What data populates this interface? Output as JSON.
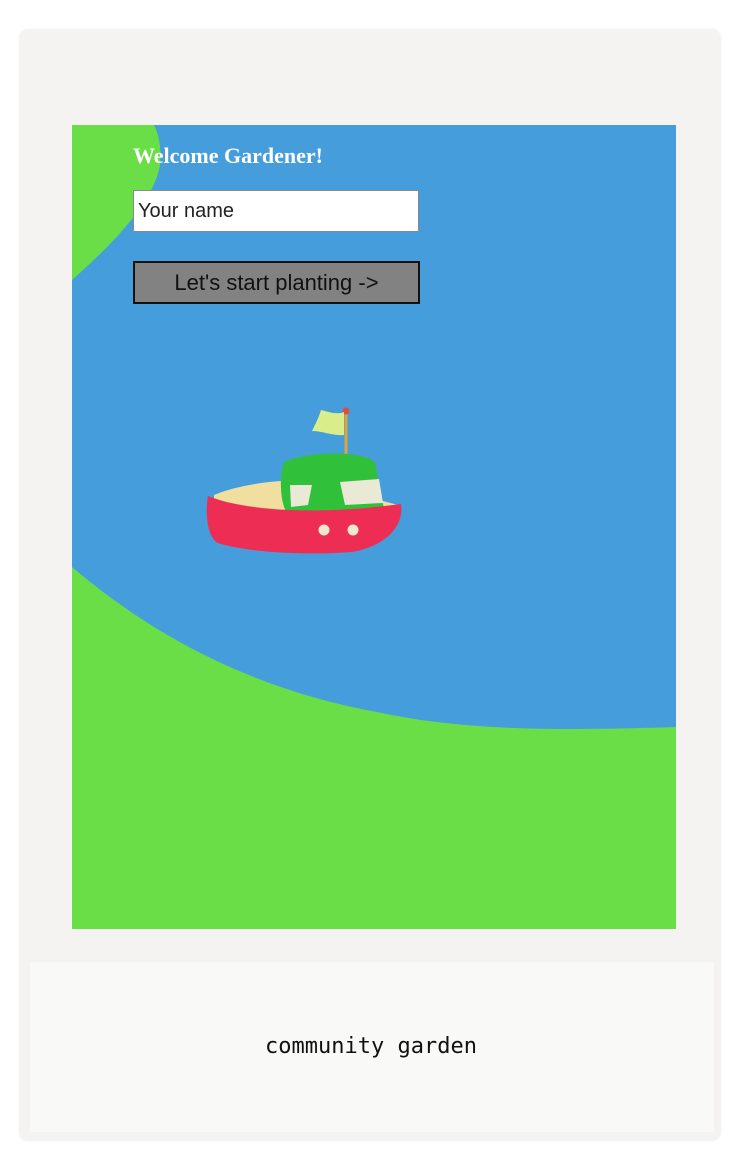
{
  "screen": {
    "welcome_text": "Welcome Gardener!",
    "name_input": {
      "placeholder": "Your name",
      "value": ""
    },
    "start_button_label": "Let's start planting ->"
  },
  "card": {
    "caption": "community garden"
  },
  "colors": {
    "water": "#469ddb",
    "grass": "#6ade46",
    "boat_hull": "#ee2d55",
    "boat_cabin": "#30c03a",
    "boat_deck": "#f1dfa0",
    "flag": "#d9ee8a",
    "button_bg": "#828282",
    "card_bg": "#f4f3f1"
  },
  "icons": {
    "boat": "boat-illustration",
    "flag": "flag-icon"
  }
}
